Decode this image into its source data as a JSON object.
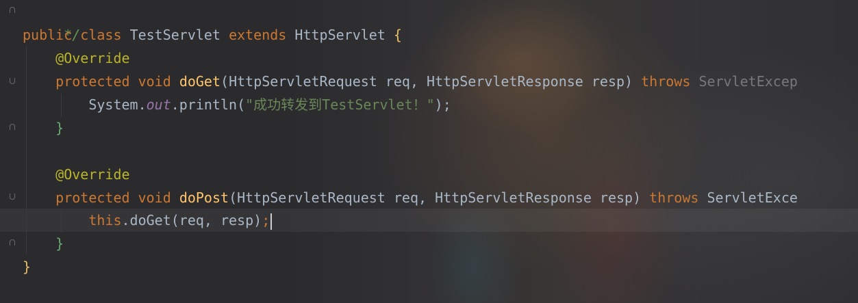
{
  "colors": {
    "keyword": "#cc7832",
    "plain": "#a9b7c6",
    "method": "#ffc66d",
    "annotation": "#bbb529",
    "string": "#6a8759",
    "static_field": "#9876aa",
    "comment": "#629755",
    "brace_outer": "#e8bf6a",
    "brace_inner": "#6aab73"
  },
  "code": {
    "comment_end": "*/",
    "class_decl": {
      "kw1": "public",
      "kw2": "class",
      "name": "TestServlet",
      "kw3": "extends",
      "parent": "HttpServlet",
      "brace": "{"
    },
    "annotation": "@Override",
    "doGet_decl": {
      "kw1": "protected",
      "kw2": "void",
      "name": "doGet",
      "params": "(HttpServletRequest req, HttpServletResponse resp)",
      "throws": "throws",
      "exception": "ServletExcep"
    },
    "println_stmt": {
      "obj": "System.",
      "field": "out",
      "call": ".println(",
      "string": "\"成功转发到TestServlet！\"",
      "end": ");"
    },
    "close_brace": "}",
    "doPost_decl": {
      "kw1": "protected",
      "kw2": "void",
      "name": "doPost",
      "params": "(HttpServletRequest req, HttpServletResponse resp)",
      "throws": "throws",
      "exception": "ServletExce"
    },
    "doget_call": {
      "this": "this",
      "call": ".doGet(req, resp)",
      "semicolon": ";"
    },
    "class_close": "}"
  }
}
